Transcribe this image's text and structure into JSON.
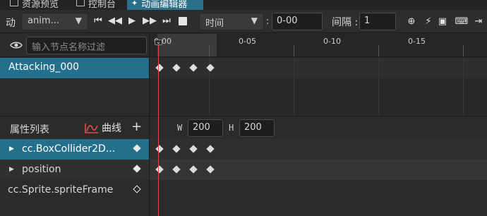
{
  "tabs": [
    {
      "label": "资源预览",
      "icon": "preview-icon"
    },
    {
      "label": "控制台",
      "icon": "console-icon"
    },
    {
      "label": "动画编辑器",
      "icon": "animation-icon",
      "active": true
    }
  ],
  "toolbar": {
    "label": "动",
    "clip_select": "anim...",
    "mode_select": "时间",
    "time_value": "0-00",
    "interval_label": "间隔 :",
    "interval_value": "1"
  },
  "node_panel": {
    "search_placeholder": "输入节点名称过滤",
    "nodes": [
      "Attacking_000"
    ]
  },
  "ruler": {
    "ticks": [
      "0-00",
      "0-05",
      "0-10",
      "0-15"
    ]
  },
  "properties": {
    "title": "属性列表",
    "curve_label": "曲线",
    "add_label": "+",
    "width_label": "W",
    "width_value": "200",
    "height_label": "H",
    "height_value": "200",
    "rows": [
      {
        "name": "cc.BoxCollider2D...",
        "selected": true,
        "keyframe": "filled"
      },
      {
        "name": "position",
        "selected": false,
        "keyframe": "filled"
      },
      {
        "name": "cc.Sprite.spriteFrame",
        "selected": false,
        "keyframe": "hollow"
      }
    ]
  },
  "colors": {
    "accent": "#236f8c",
    "playhead": "#e24545"
  }
}
